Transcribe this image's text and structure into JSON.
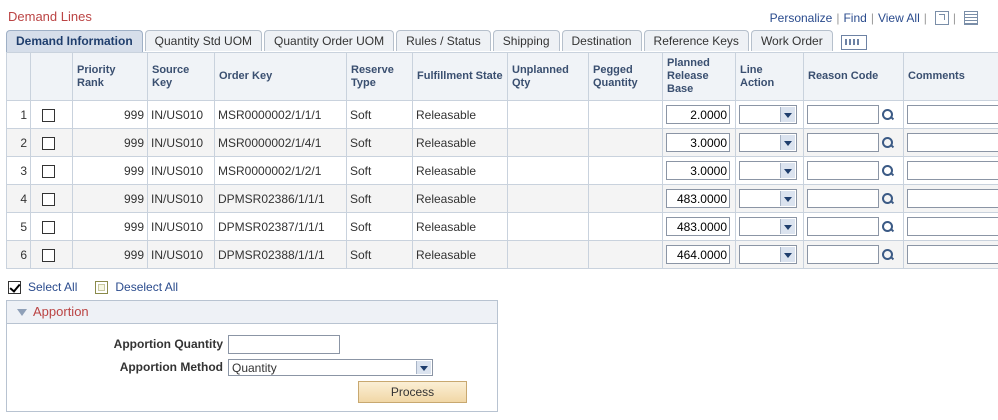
{
  "grid": {
    "title": "Demand Lines",
    "nav": {
      "personalize": "Personalize",
      "sep": "|",
      "find": "Find",
      "view_all": "View All",
      "more_icon": "new-window-icon",
      "download_icon": "spreadsheet-icon"
    },
    "tabs": [
      {
        "label": "Demand Information",
        "active": true
      },
      {
        "label": "Quantity Std UOM"
      },
      {
        "label": "Quantity Order UOM"
      },
      {
        "label": "Rules / Status"
      },
      {
        "label": "Shipping"
      },
      {
        "label": "Destination"
      },
      {
        "label": "Reference Keys"
      },
      {
        "label": "Work Order"
      }
    ],
    "headers": {
      "priority_rank": "Priority Rank",
      "source_key": "Source Key",
      "order_key": "Order Key",
      "reserve_type": "Reserve Type",
      "fulfillment_state": "Fulfillment State",
      "unplanned_qty": "Unplanned Qty",
      "pegged_quantity": "Pegged Quantity",
      "planned_release_base": "Planned Release Base",
      "line_action": "Line Action",
      "reason_code": "Reason Code",
      "comments": "Comments"
    },
    "rows": [
      {
        "num": "1",
        "priority": "999",
        "source": "IN/US010",
        "order": "MSR0000002/1/1/1",
        "reserve": "Soft",
        "state": "Releasable",
        "unplanned": "",
        "pegged": "",
        "release": "2.0000"
      },
      {
        "num": "2",
        "priority": "999",
        "source": "IN/US010",
        "order": "MSR0000002/1/4/1",
        "reserve": "Soft",
        "state": "Releasable",
        "unplanned": "",
        "pegged": "",
        "release": "3.0000"
      },
      {
        "num": "3",
        "priority": "999",
        "source": "IN/US010",
        "order": "MSR0000002/1/2/1",
        "reserve": "Soft",
        "state": "Releasable",
        "unplanned": "",
        "pegged": "",
        "release": "3.0000"
      },
      {
        "num": "4",
        "priority": "999",
        "source": "IN/US010",
        "order": "DPMSR02386/1/1/1",
        "reserve": "Soft",
        "state": "Releasable",
        "unplanned": "",
        "pegged": "",
        "release": "483.0000"
      },
      {
        "num": "5",
        "priority": "999",
        "source": "IN/US010",
        "order": "DPMSR02387/1/1/1",
        "reserve": "Soft",
        "state": "Releasable",
        "unplanned": "",
        "pegged": "",
        "release": "483.0000"
      },
      {
        "num": "6",
        "priority": "999",
        "source": "IN/US010",
        "order": "DPMSR02388/1/1/1",
        "reserve": "Soft",
        "state": "Releasable",
        "unplanned": "",
        "pegged": "",
        "release": "464.0000"
      }
    ]
  },
  "selection": {
    "select_all": "Select All",
    "deselect_all": "Deselect All"
  },
  "apportion": {
    "title": "Apportion",
    "quantity_label": "Apportion Quantity",
    "quantity_value": "",
    "method_label": "Apportion Method",
    "method_value": "Quantity",
    "process_label": "Process"
  },
  "colors": {
    "title_red": "#b44444",
    "link_blue": "#2a4b8d",
    "header_text": "#3a4f70",
    "active_tab": "#d6deea"
  }
}
